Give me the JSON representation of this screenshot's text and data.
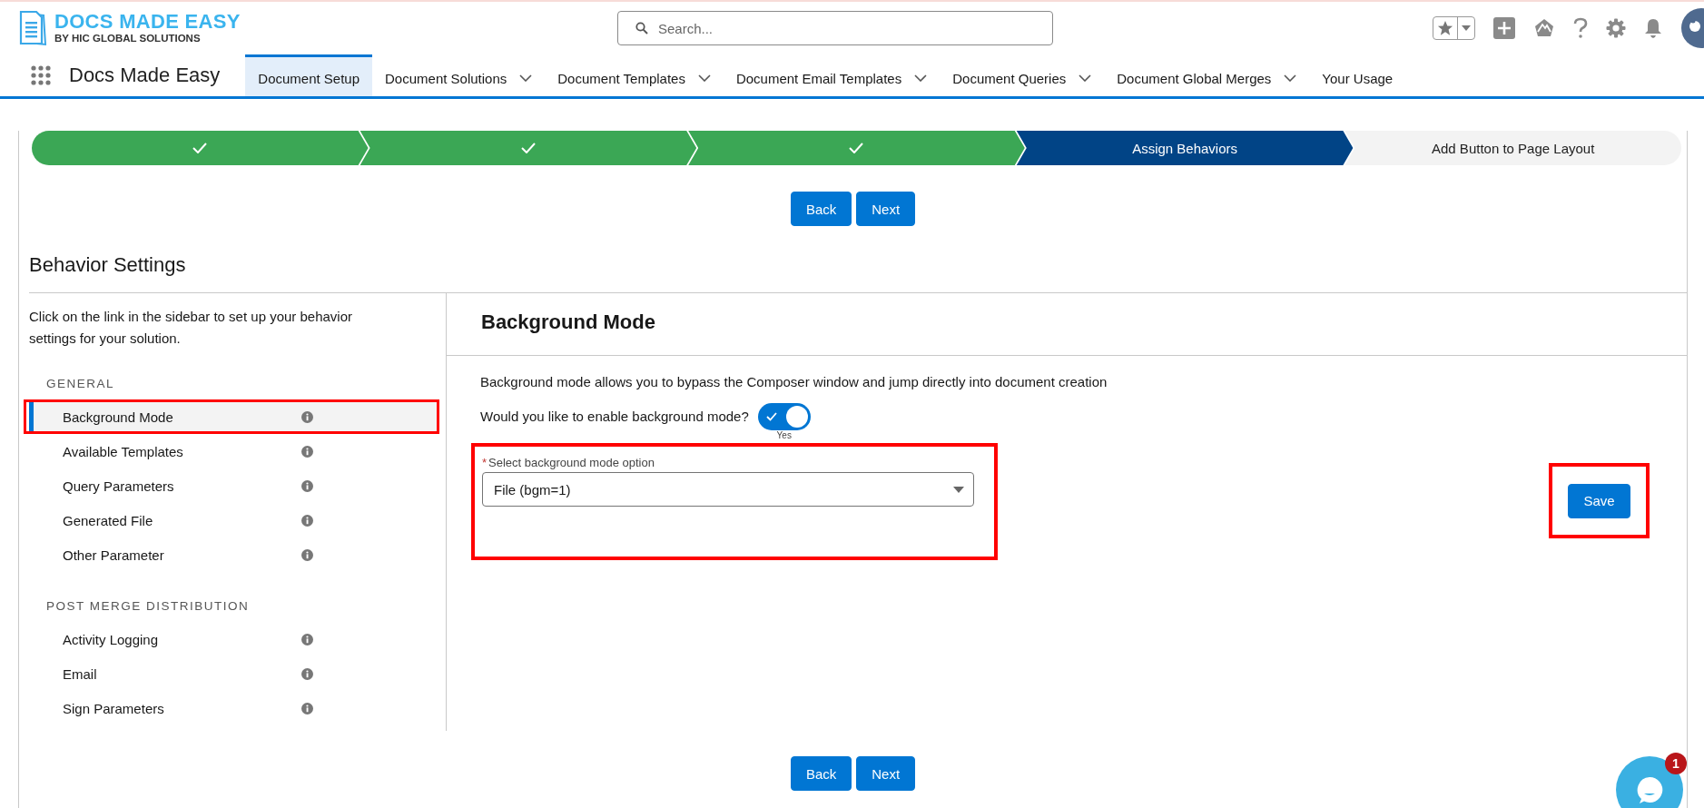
{
  "header": {
    "logo": {
      "title": "DOCS MADE EASY",
      "subtitle": "BY HIC GLOBAL SOLUTIONS"
    },
    "search": {
      "placeholder": "Search..."
    }
  },
  "nav": {
    "app_name": "Docs Made Easy",
    "tabs": [
      {
        "label": "Document Setup",
        "selected": true,
        "dropdown": false
      },
      {
        "label": "Document Solutions",
        "selected": false,
        "dropdown": true
      },
      {
        "label": "Document Templates",
        "selected": false,
        "dropdown": true
      },
      {
        "label": "Document Email Templates",
        "selected": false,
        "dropdown": true
      },
      {
        "label": "Document Queries",
        "selected": false,
        "dropdown": true
      },
      {
        "label": "Document Global Merges",
        "selected": false,
        "dropdown": true
      },
      {
        "label": "Your Usage",
        "selected": false,
        "dropdown": false
      }
    ]
  },
  "stepper": [
    {
      "complete": true,
      "selected": false
    },
    {
      "complete": true,
      "selected": false
    },
    {
      "complete": true,
      "selected": false
    },
    {
      "label": "Assign Behaviors",
      "complete": false,
      "selected": true
    },
    {
      "label": "Add Button to Page Layout",
      "complete": false,
      "selected": false
    }
  ],
  "top_buttons": [
    "Back",
    "Next"
  ],
  "page_title": "Behavior Settings",
  "sidebar": {
    "intro": "Click on the link in the sidebar to set up your behavior settings for your solution.",
    "sections": [
      {
        "title": "GENERAL",
        "items": [
          {
            "label": "Background Mode",
            "selected": true,
            "highlighted": true
          },
          {
            "label": "Available Templates",
            "selected": false,
            "highlighted": false
          },
          {
            "label": "Query Parameters",
            "selected": false,
            "highlighted": false
          },
          {
            "label": "Generated File",
            "selected": false,
            "highlighted": false
          },
          {
            "label": "Other Parameter",
            "selected": false,
            "highlighted": false
          }
        ]
      },
      {
        "title": "POST MERGE DISTRIBUTION",
        "items": [
          {
            "label": "Activity Logging",
            "selected": false,
            "highlighted": false
          },
          {
            "label": "Email",
            "selected": false,
            "highlighted": false
          },
          {
            "label": "Sign Parameters",
            "selected": false,
            "highlighted": false
          }
        ]
      }
    ]
  },
  "panel": {
    "title": "Background Mode",
    "description": "Background mode allows you to bypass the Composer window and jump directly into document creation",
    "toggle": {
      "label": "Would you like to enable background mode?",
      "checked": true,
      "state_text": "Yes"
    },
    "select": {
      "required_mark": "*",
      "label": "Select background mode option",
      "value": "File (bgm=1)",
      "highlighted": true
    },
    "save": {
      "label": "Save",
      "highlighted": true
    }
  },
  "bottom_buttons": [
    "Back",
    "Next"
  ],
  "chat": {
    "badge": "1"
  }
}
